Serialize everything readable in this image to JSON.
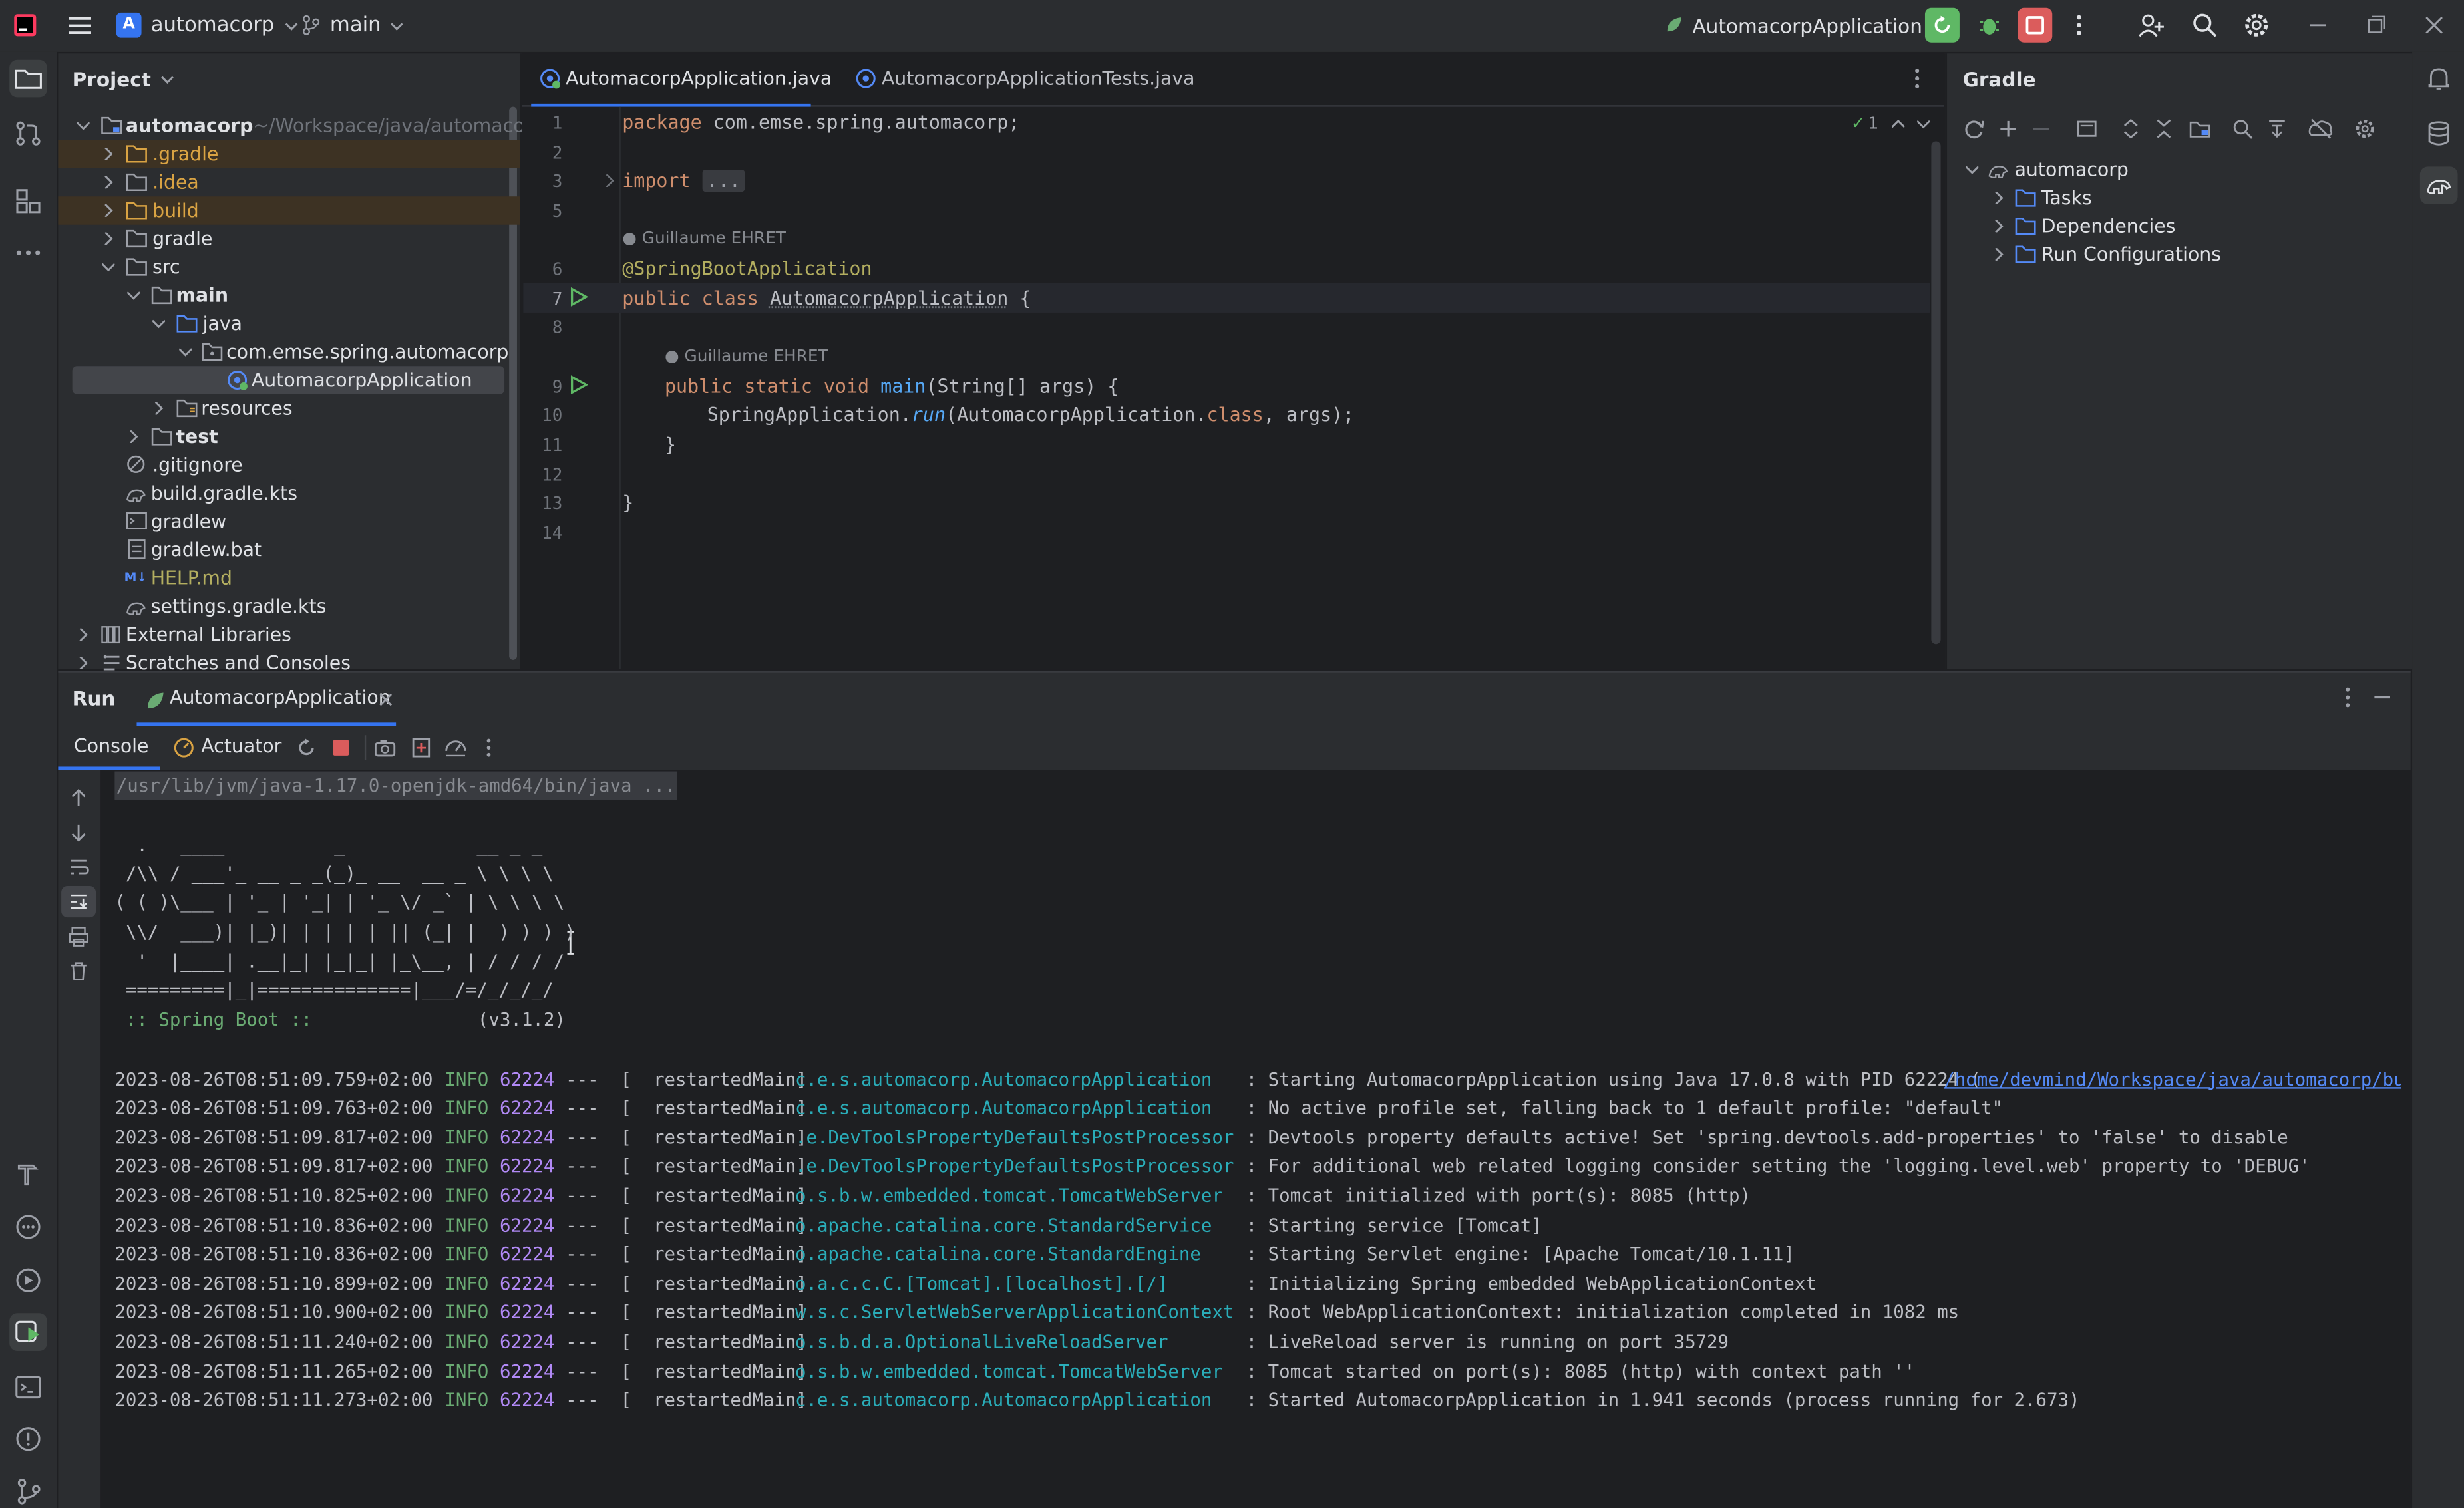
{
  "titlebar": {
    "project_initial": "A",
    "project_name": "automacorp",
    "branch": "main",
    "run_config": "AutomacorpApplication"
  },
  "project_panel": {
    "title": "Project",
    "root_name": "automacorp",
    "root_path": "~/Workspace/java/automacorp",
    "items": [
      {
        "label": ".gradle"
      },
      {
        "label": ".idea"
      },
      {
        "label": "build"
      },
      {
        "label": "gradle"
      },
      {
        "label": "src"
      },
      {
        "label": "main"
      },
      {
        "label": "java"
      },
      {
        "label": "com.emse.spring.automacorp"
      },
      {
        "label": "AutomacorpApplication"
      },
      {
        "label": "resources"
      },
      {
        "label": "test"
      },
      {
        "label": ".gitignore"
      },
      {
        "label": "build.gradle.kts"
      },
      {
        "label": "gradlew"
      },
      {
        "label": "gradlew.bat"
      },
      {
        "label": "HELP.md"
      },
      {
        "label": "settings.gradle.kts"
      },
      {
        "label": "External Libraries"
      },
      {
        "label": "Scratches and Consoles"
      }
    ]
  },
  "editor": {
    "tabs": [
      {
        "label": "AutomacorpApplication.java"
      },
      {
        "label": "AutomacorpApplicationTests.java"
      }
    ],
    "inspection_count": "1",
    "author_hint": "Guillaume EHRET",
    "line_numbers": [
      "1",
      "2",
      "3",
      "5",
      "6",
      "7",
      "8",
      "9",
      "10",
      "11",
      "12",
      "13",
      "14"
    ],
    "code": {
      "l1_kw": "package",
      "l1_rest": " com.emse.spring.automacorp;",
      "l3_kw": "import",
      "l3_fold": "...",
      "l6": "@SpringBootApplication",
      "l7_kw": "public class",
      "l7_name": "AutomacorpApplication",
      "l7_brace": " {",
      "l9_kw": "public static void",
      "l9_name": "main",
      "l9_rest": "(String[] args) {",
      "l10_a": "SpringApplication.",
      "l10_run": "run",
      "l10_b": "(AutomacorpApplication.",
      "l10_cls": "class",
      "l10_c": ", args);",
      "l11": "}",
      "l13": "}"
    }
  },
  "gradle_panel": {
    "title": "Gradle",
    "root": "automacorp",
    "items": [
      {
        "label": "Tasks"
      },
      {
        "label": "Dependencies"
      },
      {
        "label": "Run Configurations"
      }
    ]
  },
  "run_panel": {
    "title": "Run",
    "tab_label": "AutomacorpApplication",
    "subtabs": {
      "console": "Console",
      "actuator": "Actuator"
    },
    "cmd": "/usr/lib/jvm/java-1.17.0-openjdk-amd64/bin/java ...",
    "banner": [
      "  .   ____          _            __ _ _",
      " /\\\\ / ___'_ __ _ _(_)_ __  __ _ \\ \\ \\ \\",
      "( ( )\\___ | '_ | '_| | '_ \\/ _` | \\ \\ \\ \\",
      " \\\\/  ___)| |_)| | | | | || (_| |  ) ) ) )",
      "  '  |____| .__|_| |_|_| |_\\__, | / / / /",
      " =========|_|==============|___/=/_/_/_/"
    ],
    "spring_boot_label": " :: Spring Boot ::",
    "spring_boot_version": "(v3.1.2)",
    "logs": [
      {
        "ts": "2023-08-26T08:51:09.759+02:00",
        "level": "INFO",
        "pid": "62224",
        "thread": "---  [  restartedMain]",
        "logger": "c.e.s.automacorp.AutomacorpApplication  ",
        "msg": " : Starting AutomacorpApplication using Java 17.0.8 with PID 62224 (",
        "link": "/home/devmind/Workspace/java/automacorp/buil"
      },
      {
        "ts": "2023-08-26T08:51:09.763+02:00",
        "level": "INFO",
        "pid": "62224",
        "thread": "---  [  restartedMain]",
        "logger": "c.e.s.automacorp.AutomacorpApplication  ",
        "msg": " : No active profile set, falling back to 1 default profile: \"default\"",
        "link": ""
      },
      {
        "ts": "2023-08-26T08:51:09.817+02:00",
        "level": "INFO",
        "pid": "62224",
        "thread": "---  [  restartedMain]",
        "logger": ".e.DevToolsPropertyDefaultsPostProcessor",
        "msg": " : Devtools property defaults active! Set 'spring.devtools.add-properties' to 'false' to disable",
        "link": ""
      },
      {
        "ts": "2023-08-26T08:51:09.817+02:00",
        "level": "INFO",
        "pid": "62224",
        "thread": "---  [  restartedMain]",
        "logger": ".e.DevToolsPropertyDefaultsPostProcessor",
        "msg": " : For additional web related logging consider setting the 'logging.level.web' property to 'DEBUG'",
        "link": ""
      },
      {
        "ts": "2023-08-26T08:51:10.825+02:00",
        "level": "INFO",
        "pid": "62224",
        "thread": "---  [  restartedMain]",
        "logger": "o.s.b.w.embedded.tomcat.TomcatWebServer ",
        "msg": " : Tomcat initialized with port(s): 8085 (http)",
        "link": ""
      },
      {
        "ts": "2023-08-26T08:51:10.836+02:00",
        "level": "INFO",
        "pid": "62224",
        "thread": "---  [  restartedMain]",
        "logger": "o.apache.catalina.core.StandardService  ",
        "msg": " : Starting service [Tomcat]",
        "link": ""
      },
      {
        "ts": "2023-08-26T08:51:10.836+02:00",
        "level": "INFO",
        "pid": "62224",
        "thread": "---  [  restartedMain]",
        "logger": "o.apache.catalina.core.StandardEngine   ",
        "msg": " : Starting Servlet engine: [Apache Tomcat/10.1.11]",
        "link": ""
      },
      {
        "ts": "2023-08-26T08:51:10.899+02:00",
        "level": "INFO",
        "pid": "62224",
        "thread": "---  [  restartedMain]",
        "logger": "o.a.c.c.C.[Tomcat].[localhost].[/]      ",
        "msg": " : Initializing Spring embedded WebApplicationContext",
        "link": ""
      },
      {
        "ts": "2023-08-26T08:51:10.900+02:00",
        "level": "INFO",
        "pid": "62224",
        "thread": "---  [  restartedMain]",
        "logger": "w.s.c.ServletWebServerApplicationContext",
        "msg": " : Root WebApplicationContext: initialization completed in 1082 ms",
        "link": ""
      },
      {
        "ts": "2023-08-26T08:51:11.240+02:00",
        "level": "INFO",
        "pid": "62224",
        "thread": "---  [  restartedMain]",
        "logger": "o.s.b.d.a.OptionalLiveReloadServer      ",
        "msg": " : LiveReload server is running on port 35729",
        "link": ""
      },
      {
        "ts": "2023-08-26T08:51:11.265+02:00",
        "level": "INFO",
        "pid": "62224",
        "thread": "---  [  restartedMain]",
        "logger": "o.s.b.w.embedded.tomcat.TomcatWebServer ",
        "msg": " : Tomcat started on port(s): 8085 (http) with context path ''",
        "link": ""
      },
      {
        "ts": "2023-08-26T08:51:11.273+02:00",
        "level": "INFO",
        "pid": "62224",
        "thread": "---  [  restartedMain]",
        "logger": "c.e.s.automacorp.AutomacorpApplication  ",
        "msg": " : Started AutomacorpApplication in 1.941 seconds (process running for 2.673)",
        "link": ""
      }
    ]
  },
  "colors": {
    "accent": "#3574f0",
    "run_green": "#5fb865",
    "stop_red": "#db5c5c"
  }
}
